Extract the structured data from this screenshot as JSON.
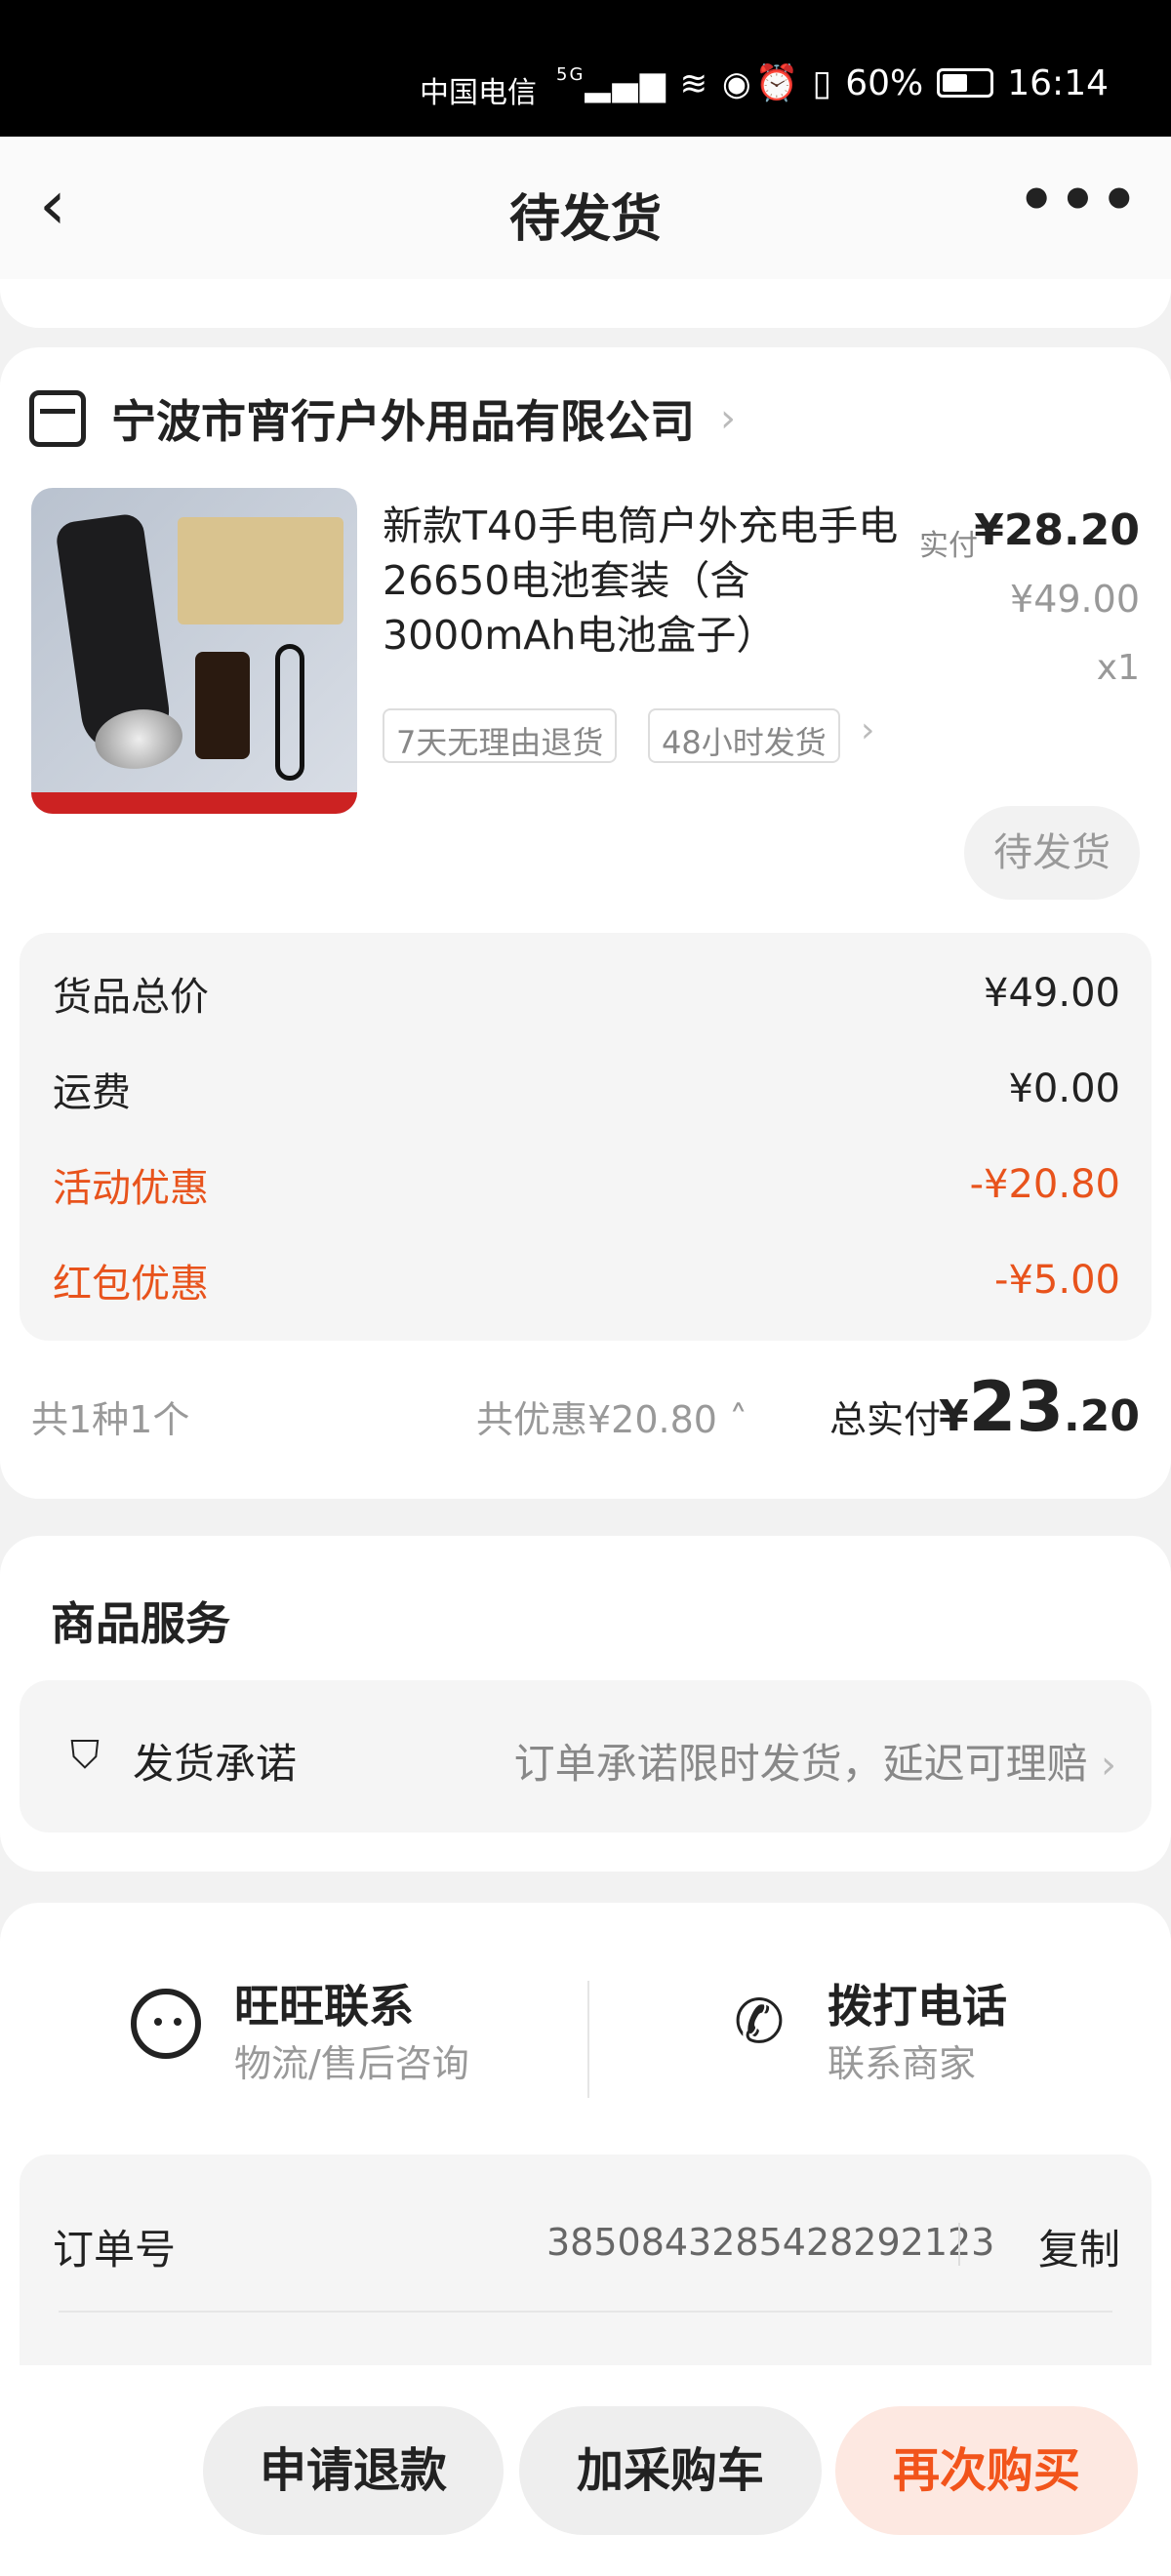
{
  "status_bar": {
    "carrier": "中国电信",
    "network": "5G",
    "battery": "60%",
    "battery_level": 0.6,
    "time": "16:14"
  },
  "nav": {
    "title": "待发货"
  },
  "store": {
    "name": "宁波市宵行户外用品有限公司"
  },
  "product": {
    "title": "新款T40手电筒户外充电手电26650电池套装（含3000mAh电池盒子）",
    "paid_label": "实付",
    "paid_price": "¥28.20",
    "original_price": "¥49.00",
    "quantity": "x1",
    "tags": [
      "7天无理由退货",
      "48小时发货"
    ],
    "status": "待发货"
  },
  "price_breakdown": [
    {
      "label": "货品总价",
      "value": "¥49.00",
      "highlight": false
    },
    {
      "label": "运费",
      "value": "¥0.00",
      "highlight": false
    },
    {
      "label": "活动优惠",
      "value": "-¥20.80",
      "highlight": true
    },
    {
      "label": "红包优惠",
      "value": "-¥5.00",
      "highlight": true
    }
  ],
  "summary": {
    "count": "共1种1个",
    "discount": "共优惠¥20.80",
    "total_label": "总实付",
    "total_yen": "¥",
    "total_int": "23",
    "total_dec": ".20"
  },
  "service": {
    "title": "商品服务",
    "item_name": "发货承诺",
    "item_desc": "订单承诺限时发货，延迟可理赔"
  },
  "contact": {
    "wangwang_title": "旺旺联系",
    "wangwang_sub": "物流/售后咨询",
    "phone_title": "拨打电话",
    "phone_sub": "联系商家"
  },
  "order": {
    "number_label": "订单号",
    "number": "3850843285428292123",
    "copy": "复制"
  },
  "actions": {
    "refund": "申请退款",
    "add_cart": "加采购车",
    "rebuy": "再次购买"
  },
  "colors": {
    "accent": "#f2541b",
    "discount": "#e8531c"
  }
}
